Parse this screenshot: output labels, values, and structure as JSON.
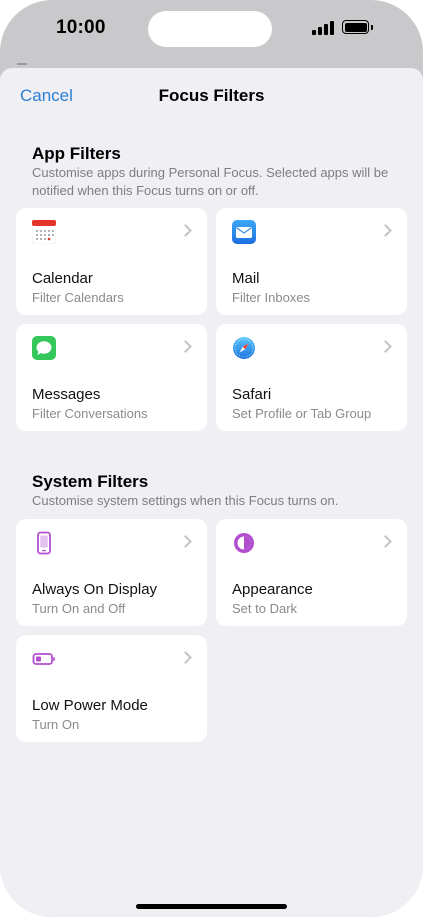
{
  "status_bar": {
    "time": "10:00"
  },
  "nav": {
    "cancel_label": "Cancel",
    "title": "Focus Filters"
  },
  "app_filters": {
    "title": "App Filters",
    "description": "Customise apps during Personal Focus. Selected apps will be notified when this Focus turns on or off.",
    "items": [
      {
        "name": "Calendar",
        "subtitle": "Filter Calendars",
        "icon": "calendar-icon"
      },
      {
        "name": "Mail",
        "subtitle": "Filter Inboxes",
        "icon": "mail-icon"
      },
      {
        "name": "Messages",
        "subtitle": "Filter Conversations",
        "icon": "messages-icon"
      },
      {
        "name": "Safari",
        "subtitle": "Set Profile or Tab Group",
        "icon": "safari-icon"
      }
    ]
  },
  "system_filters": {
    "title": "System Filters",
    "description": "Customise system settings when this Focus turns on.",
    "items": [
      {
        "name": "Always On Display",
        "subtitle": "Turn On and Off",
        "icon": "phone-icon"
      },
      {
        "name": "Appearance",
        "subtitle": "Set to Dark",
        "icon": "appearance-icon"
      },
      {
        "name": "Low Power Mode",
        "subtitle": "Turn On",
        "icon": "battery-low-icon"
      }
    ]
  },
  "colors": {
    "accent": "#2a7fd4",
    "sheet_background": "#efeff4",
    "purple_icon": "#b24fd0",
    "messages_green": "#34c759"
  }
}
